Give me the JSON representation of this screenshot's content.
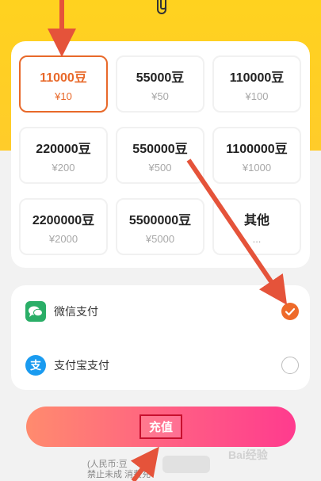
{
  "packages": [
    {
      "amount": "11000豆",
      "price": "¥10",
      "selected": true
    },
    {
      "amount": "55000豆",
      "price": "¥50",
      "selected": false
    },
    {
      "amount": "110000豆",
      "price": "¥100",
      "selected": false
    },
    {
      "amount": "220000豆",
      "price": "¥200",
      "selected": false
    },
    {
      "amount": "550000豆",
      "price": "¥500",
      "selected": false
    },
    {
      "amount": "1100000豆",
      "price": "¥1000",
      "selected": false
    },
    {
      "amount": "2200000豆",
      "price": "¥2000",
      "selected": false
    },
    {
      "amount": "5500000豆",
      "price": "¥5000",
      "selected": false
    },
    {
      "amount": "其他",
      "price": "...",
      "selected": false
    }
  ],
  "payment": {
    "methods": [
      {
        "label": "微信支付",
        "icon": "wechat-pay-icon",
        "selected": true,
        "color": "#2aae67"
      },
      {
        "label": "支付宝支付",
        "icon": "alipay-icon",
        "selected": false,
        "color": "#1a9bf0"
      }
    ]
  },
  "charge_button": {
    "label": "充值"
  },
  "notes": {
    "line1": "(人民币:豆",
    "line2": "禁止未成 消费充"
  },
  "watermark": "Bai经验",
  "colors": {
    "accent": "#e8692a",
    "top_band": "#ffd21f",
    "arrow": "#e5533a",
    "highlight_box": "#c8102e"
  }
}
